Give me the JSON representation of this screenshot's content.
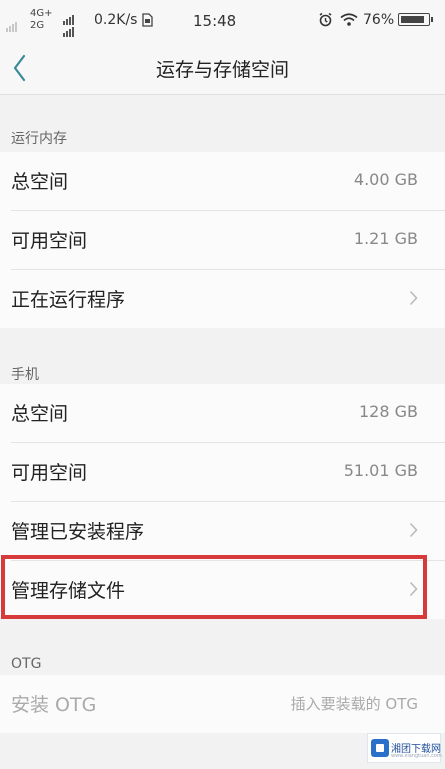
{
  "status_bar": {
    "network_top": "4G+",
    "network_bottom": "2G",
    "speed": "0.2K/s",
    "time": "15:48",
    "battery_percent": "76%",
    "battery_level": 0.76,
    "icons": [
      "signal-icon",
      "sim-icon",
      "alarm-icon",
      "wifi-icon",
      "battery-icon"
    ]
  },
  "header": {
    "title": "运存与存储空间",
    "back_icon": "chevron-left-icon"
  },
  "sections": {
    "ram": {
      "title": "运行内存",
      "rows": [
        {
          "label": "总空间",
          "value": "4.00 GB"
        },
        {
          "label": "可用空间",
          "value": "1.21 GB"
        },
        {
          "label": "正在运行程序"
        }
      ]
    },
    "phone": {
      "title": "手机",
      "rows": [
        {
          "label": "总空间",
          "value": "128 GB"
        },
        {
          "label": "可用空间",
          "value": "51.01 GB"
        },
        {
          "label": "管理已安装程序"
        },
        {
          "label": "管理存储文件"
        }
      ]
    },
    "otg": {
      "title": "OTG",
      "rows": [
        {
          "label": "安装 OTG",
          "value": "插入要装载的 OTG"
        }
      ]
    }
  },
  "annotation": {
    "highlight_color": "#d63a3a"
  },
  "watermark": {
    "text": "湘团下载网",
    "subtext": "www.xiangtuan.com"
  },
  "colors": {
    "background": "#f2f2f2",
    "row_background": "#fbfbfb",
    "primary_text": "#222222",
    "secondary_text": "#888888",
    "back_icon": "#3a8a9a"
  }
}
